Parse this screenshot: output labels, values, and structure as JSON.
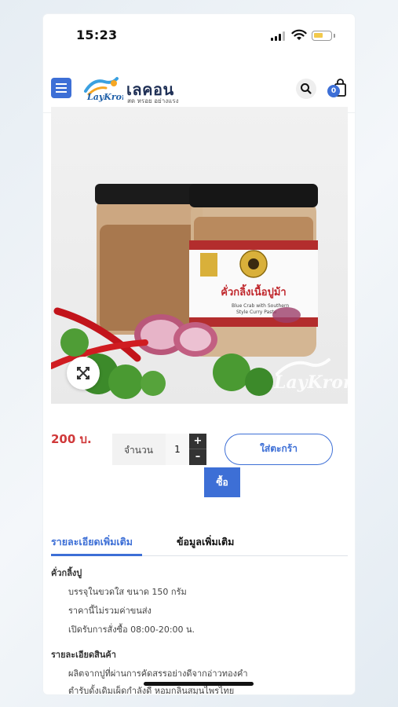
{
  "status_bar": {
    "time": "15:23"
  },
  "header": {
    "logo_title": "เลคอน",
    "logo_tagline": "สด หรอย อย่างแรง",
    "logo_mark_text": "LayKron",
    "cart_count": "0"
  },
  "product": {
    "image_watermark": "LayKron",
    "price": "200 บ.",
    "quantity_label": "จำนวน",
    "quantity_value": "1",
    "plus_label": "+",
    "minus_label": "–",
    "add_to_cart_label": "ใส่ตะกร้า",
    "buy_label": "ซื้อ"
  },
  "tabs": [
    {
      "label": "รายละเอียดเพิ่มเติม",
      "active": true
    },
    {
      "label": "ข้อมูลเพิ่มเติม",
      "active": false
    }
  ],
  "description": {
    "section1_title": "คั่วกลิ้งปู",
    "section1_lines": [
      "บรรจุในขวดใส ขนาด 150 กรัม",
      "ราคานี้ไม่รวมค่าขนส่ง",
      "เปิดรับการสั่งซื้อ 08:00-20:00 น."
    ],
    "section2_title": "รายละเอียดสินค้า",
    "section2_lines": [
      "ผลิตจากปูที่ผ่านการคัดสรรอย่างดีจากอ่าวทองคำ",
      "ตำรับดั้งเดิมเผ็ดกำลังดี หอมกลิ่นสมุนไพรไทย"
    ]
  },
  "jar_label": {
    "title": "คั่วกลิ้งเนื้อปูม้า",
    "subtitle": "Blue Crab with Southern Style Curry Paste"
  },
  "colors": {
    "accent": "#3d6fd6",
    "price": "#d0393a",
    "background": "#ffffff"
  }
}
